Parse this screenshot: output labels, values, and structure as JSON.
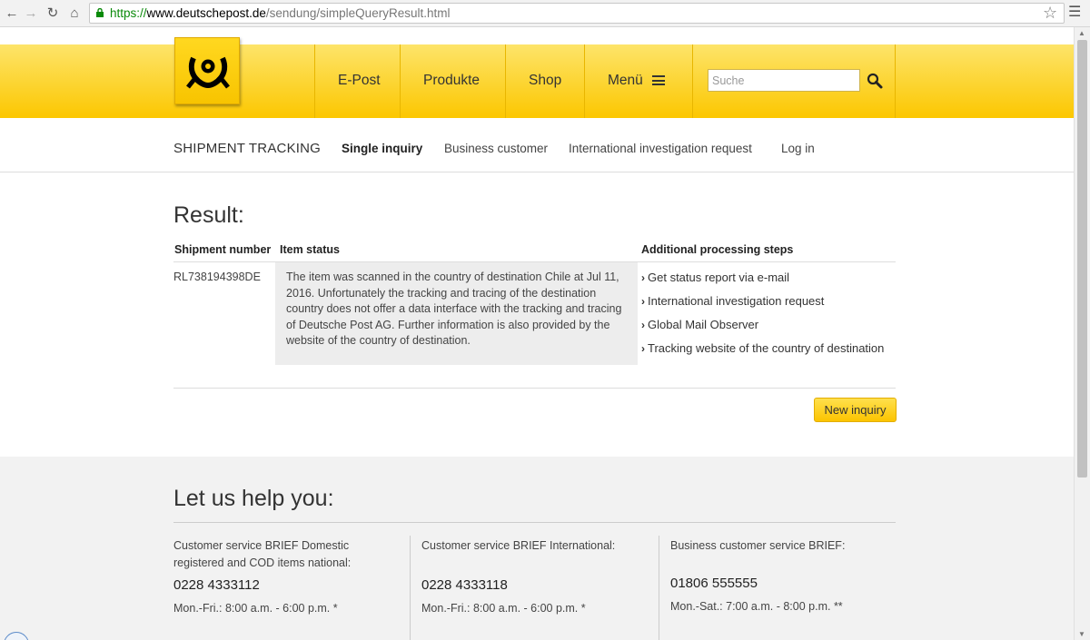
{
  "browser": {
    "url_scheme": "https://",
    "url_host": "www.deutschepost.de",
    "url_path": "/sendung/simpleQueryResult.html"
  },
  "header": {
    "logo_icon": "posthorn-icon",
    "nav": [
      {
        "label": "E-Post"
      },
      {
        "label": "Produkte"
      },
      {
        "label": "Shop"
      },
      {
        "label": "Menü"
      }
    ],
    "search_placeholder": "Suche"
  },
  "subnav": {
    "title": "SHIPMENT TRACKING",
    "links": [
      {
        "label": "Single inquiry",
        "active": true
      },
      {
        "label": "Business customer"
      },
      {
        "label": "International investigation request"
      },
      {
        "label": "Log in"
      }
    ]
  },
  "result": {
    "heading": "Result:",
    "columns": [
      "Shipment number",
      "Item status",
      "Additional processing steps"
    ],
    "shipment_number": "RL738194398DE",
    "status_text": "The item was scanned in the country of destination Chile at Jul 11, 2016. Unfortunately the tracking and tracing of the destination country does not offer a data interface with the tracking and tracing of Deutsche Post AG. Further information is also provided by the website of the country of destination.",
    "steps": [
      "Get status report via e-mail",
      "International investigation request",
      "Global Mail Observer",
      "Tracking website of the country of destination"
    ],
    "new_inquiry_label": "New inquiry"
  },
  "help": {
    "heading": "Let us help you:",
    "columns": [
      {
        "title": "Customer service BRIEF Domestic registered and COD items national:",
        "phone": "0228 4333112",
        "hours": "Mon.-Fri.: 8:00 a.m. - 6:00 p.m. *"
      },
      {
        "title": "Customer service BRIEF International:",
        "phone": "0228 4333118",
        "hours": "Mon.-Fri.: 8:00 a.m. - 6:00 p.m. *"
      },
      {
        "title": "Business customer service BRIEF:",
        "phone": "01806 555555",
        "hours": "Mon.-Sat.: 7:00 a.m. - 8:00 p.m. **"
      }
    ]
  },
  "colors": {
    "brand_yellow": "#fcc700",
    "text": "#333333"
  }
}
